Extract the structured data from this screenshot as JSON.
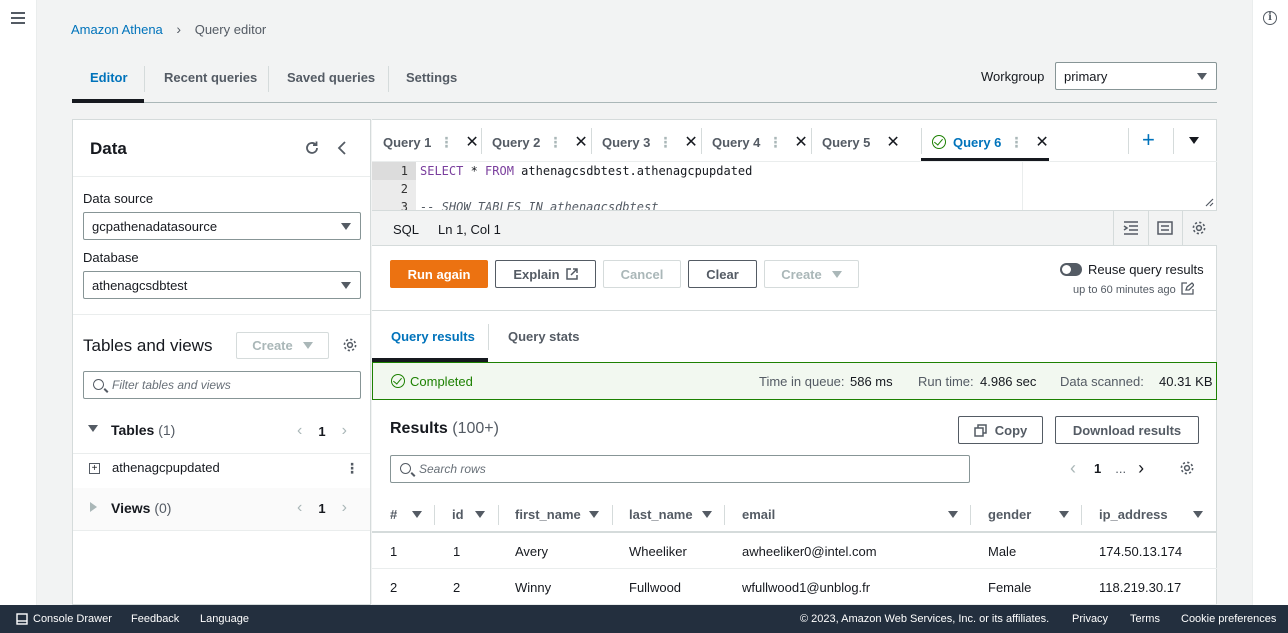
{
  "breadcrumb": {
    "root": "Amazon Athena",
    "current": "Query editor"
  },
  "tabs": [
    {
      "label": "Editor"
    },
    {
      "label": "Recent queries"
    },
    {
      "label": "Saved queries"
    },
    {
      "label": "Settings"
    }
  ],
  "workgroup": {
    "label": "Workgroup",
    "value": "primary"
  },
  "data_panel": {
    "title": "Data",
    "data_source_label": "Data source",
    "data_source_value": "gcpathenadatasource",
    "database_label": "Database",
    "database_value": "athenagcsdbtest",
    "tables_views_title": "Tables and views",
    "create_label": "Create",
    "filter_placeholder": "Filter tables and views",
    "tables_label": "Tables",
    "tables_count": "(1)",
    "tables_page": "1",
    "table_item": "athenagcpupdated",
    "views_label": "Views",
    "views_count": "(0)",
    "views_page": "1"
  },
  "query_tabs": [
    "Query 1",
    "Query 2",
    "Query 3",
    "Query 4",
    "Query 5",
    "Query 6"
  ],
  "editor": {
    "lines": [
      "1",
      "2",
      "3"
    ],
    "line1_kw1": "SELECT",
    "line1_rest1": " * ",
    "line1_kw2": "FROM",
    "line1_rest2": " athenagcsdbtest.athenagcpupdated",
    "line3": "-- SHOW TABLES IN athenagcsdbtest",
    "language": "SQL",
    "cursor": "Ln 1, Col 1"
  },
  "actions": {
    "run": "Run again",
    "explain": "Explain",
    "cancel": "Cancel",
    "clear": "Clear",
    "create": "Create",
    "reuse": "Reuse query results",
    "reuse_sub": "up to 60 minutes ago"
  },
  "result_tabs": [
    "Query results",
    "Query stats"
  ],
  "status": {
    "state": "Completed",
    "queue_label": "Time in queue:",
    "queue_value": "586 ms",
    "run_label": "Run time:",
    "run_value": "4.986 sec",
    "scanned_label": "Data scanned:",
    "scanned_value": "40.31 KB"
  },
  "results": {
    "title": "Results",
    "count": "(100+)",
    "copy": "Copy",
    "download": "Download results",
    "search_placeholder": "Search rows",
    "page": "1",
    "ellipsis": "..."
  },
  "table": {
    "columns": [
      "#",
      "id",
      "first_name",
      "last_name",
      "email",
      "gender",
      "ip_address"
    ],
    "rows": [
      [
        "1",
        "1",
        "Avery",
        "Wheeliker",
        "awheeliker0@intel.com",
        "Male",
        "174.50.13.174"
      ],
      [
        "2",
        "2",
        "Winny",
        "Fullwood",
        "wfullwood1@unblog.fr",
        "Female",
        "118.219.30.17"
      ]
    ]
  },
  "footer": {
    "drawer": "Console Drawer",
    "feedback": "Feedback",
    "language": "Language",
    "copyright": "© 2023, Amazon Web Services, Inc. or its affiliates.",
    "privacy": "Privacy",
    "terms": "Terms",
    "cookies": "Cookie preferences"
  }
}
